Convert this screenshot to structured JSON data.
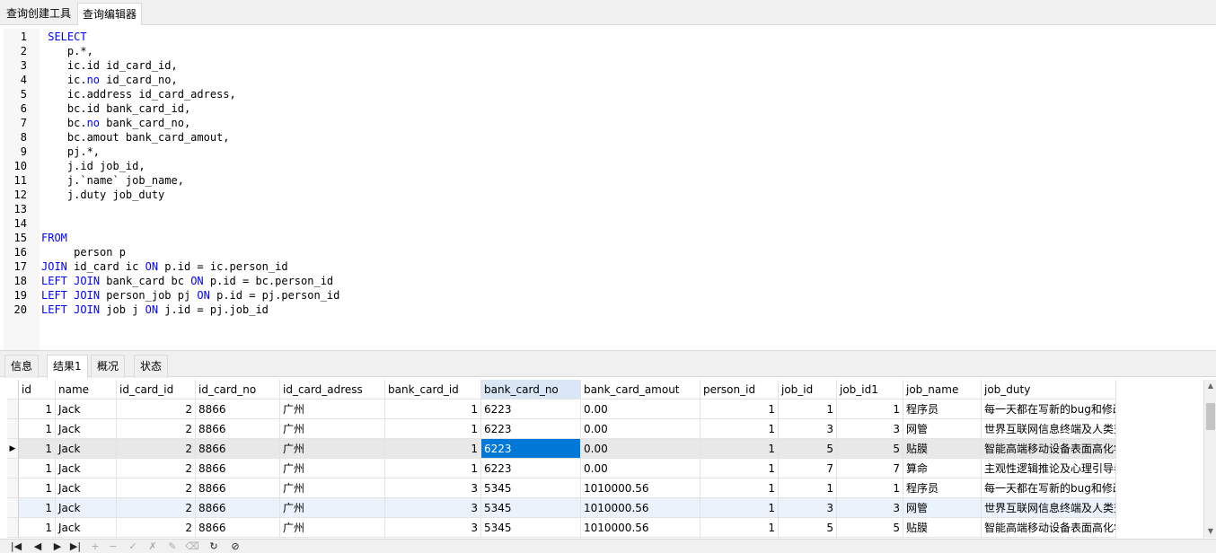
{
  "top_tabs": [
    "查询创建工具",
    "查询编辑器"
  ],
  "editor": {
    "lines": [
      [
        {
          "t": " "
        },
        {
          "t": "SELECT",
          "k": 1
        }
      ],
      [
        {
          "t": "    p.*,"
        }
      ],
      [
        {
          "t": "    ic.id id_card_id,"
        }
      ],
      [
        {
          "t": "    ic."
        },
        {
          "t": "no",
          "k": 1
        },
        {
          "t": " id_card_no,"
        }
      ],
      [
        {
          "t": "    ic.address id_card_adress,"
        }
      ],
      [
        {
          "t": "    bc.id bank_card_id,"
        }
      ],
      [
        {
          "t": "    bc."
        },
        {
          "t": "no",
          "k": 1
        },
        {
          "t": " bank_card_no,"
        }
      ],
      [
        {
          "t": "    bc.amout bank_card_amout,"
        }
      ],
      [
        {
          "t": "    pj.*,"
        }
      ],
      [
        {
          "t": "    j.id job_id,"
        }
      ],
      [
        {
          "t": "    j.`name` job_name,"
        }
      ],
      [
        {
          "t": "    j.duty job_duty"
        }
      ],
      [],
      [],
      [
        {
          "t": "FROM",
          "k": 1
        }
      ],
      [
        {
          "t": "     person p"
        }
      ],
      [
        {
          "t": "JOIN",
          "k": 1
        },
        {
          "t": " id_card ic "
        },
        {
          "t": "ON",
          "k": 1
        },
        {
          "t": " p.id = ic.person_id"
        }
      ],
      [
        {
          "t": "LEFT",
          "k": 1
        },
        {
          "t": " "
        },
        {
          "t": "JOIN",
          "k": 1
        },
        {
          "t": " bank_card bc "
        },
        {
          "t": "ON",
          "k": 1
        },
        {
          "t": " p.id = bc.person_id"
        }
      ],
      [
        {
          "t": "LEFT",
          "k": 1
        },
        {
          "t": " "
        },
        {
          "t": "JOIN",
          "k": 1
        },
        {
          "t": " person_job pj "
        },
        {
          "t": "ON",
          "k": 1
        },
        {
          "t": " p.id = pj.person_id"
        }
      ],
      [
        {
          "t": "LEFT",
          "k": 1
        },
        {
          "t": " "
        },
        {
          "t": "JOIN",
          "k": 1
        },
        {
          "t": " job j "
        },
        {
          "t": "ON",
          "k": 1
        },
        {
          "t": " j.id = pj.job_id"
        }
      ]
    ],
    "keyword_color": "#0000ff"
  },
  "result_tabs": [
    "信息",
    "结果1",
    "概况",
    "状态"
  ],
  "active_result_tab": "结果1",
  "grid": {
    "columns": [
      "id",
      "name",
      "id_card_id",
      "id_card_no",
      "id_card_adress",
      "bank_card_id",
      "bank_card_no",
      "bank_card_amout",
      "person_id",
      "job_id",
      "job_id1",
      "job_name",
      "job_duty"
    ],
    "numeric_columns": [
      0,
      2,
      5,
      8,
      9,
      10
    ],
    "selected_column": "bank_card_no",
    "current_row": 2,
    "rows": [
      [
        "1",
        "Jack",
        "2",
        "8866",
        "广州",
        "1",
        "6223",
        "0.00",
        "1",
        "1",
        "1",
        "程序员",
        "每一天都在写新的bug和修改"
      ],
      [
        "1",
        "Jack",
        "2",
        "8866",
        "广州",
        "1",
        "6223",
        "0.00",
        "1",
        "3",
        "3",
        "网管",
        "世界互联网信息终端及人类交"
      ],
      [
        "1",
        "Jack",
        "2",
        "8866",
        "广州",
        "1",
        "6223",
        "0.00",
        "1",
        "5",
        "5",
        "贴膜",
        "智能高端移动设备表面高化学"
      ],
      [
        "1",
        "Jack",
        "2",
        "8866",
        "广州",
        "1",
        "6223",
        "0.00",
        "1",
        "7",
        "7",
        "算命",
        "主观性逻辑推论及心理引导者"
      ],
      [
        "1",
        "Jack",
        "2",
        "8866",
        "广州",
        "3",
        "5345",
        "1010000.56",
        "1",
        "1",
        "1",
        "程序员",
        "每一天都在写新的bug和修改"
      ],
      [
        "1",
        "Jack",
        "2",
        "8866",
        "广州",
        "3",
        "5345",
        "1010000.56",
        "1",
        "3",
        "3",
        "网管",
        "世界互联网信息终端及人类交"
      ],
      [
        "1",
        "Jack",
        "2",
        "8866",
        "广州",
        "3",
        "5345",
        "1010000.56",
        "1",
        "5",
        "5",
        "贴膜",
        "智能高端移动设备表面高化学"
      ]
    ],
    "highlight_color": "#0078d7",
    "current_row_bg": "#e8e8e8",
    "alt_row_bg": "#eaf2fc"
  },
  "toolbar_icons": [
    "first-record-icon",
    "prev-record-icon",
    "next-record-icon",
    "last-record-icon",
    "add-record-icon",
    "delete-record-icon",
    "apply-icon",
    "discard-icon",
    "edit-icon",
    "clear-icon",
    "refresh-icon",
    "stop-icon"
  ]
}
